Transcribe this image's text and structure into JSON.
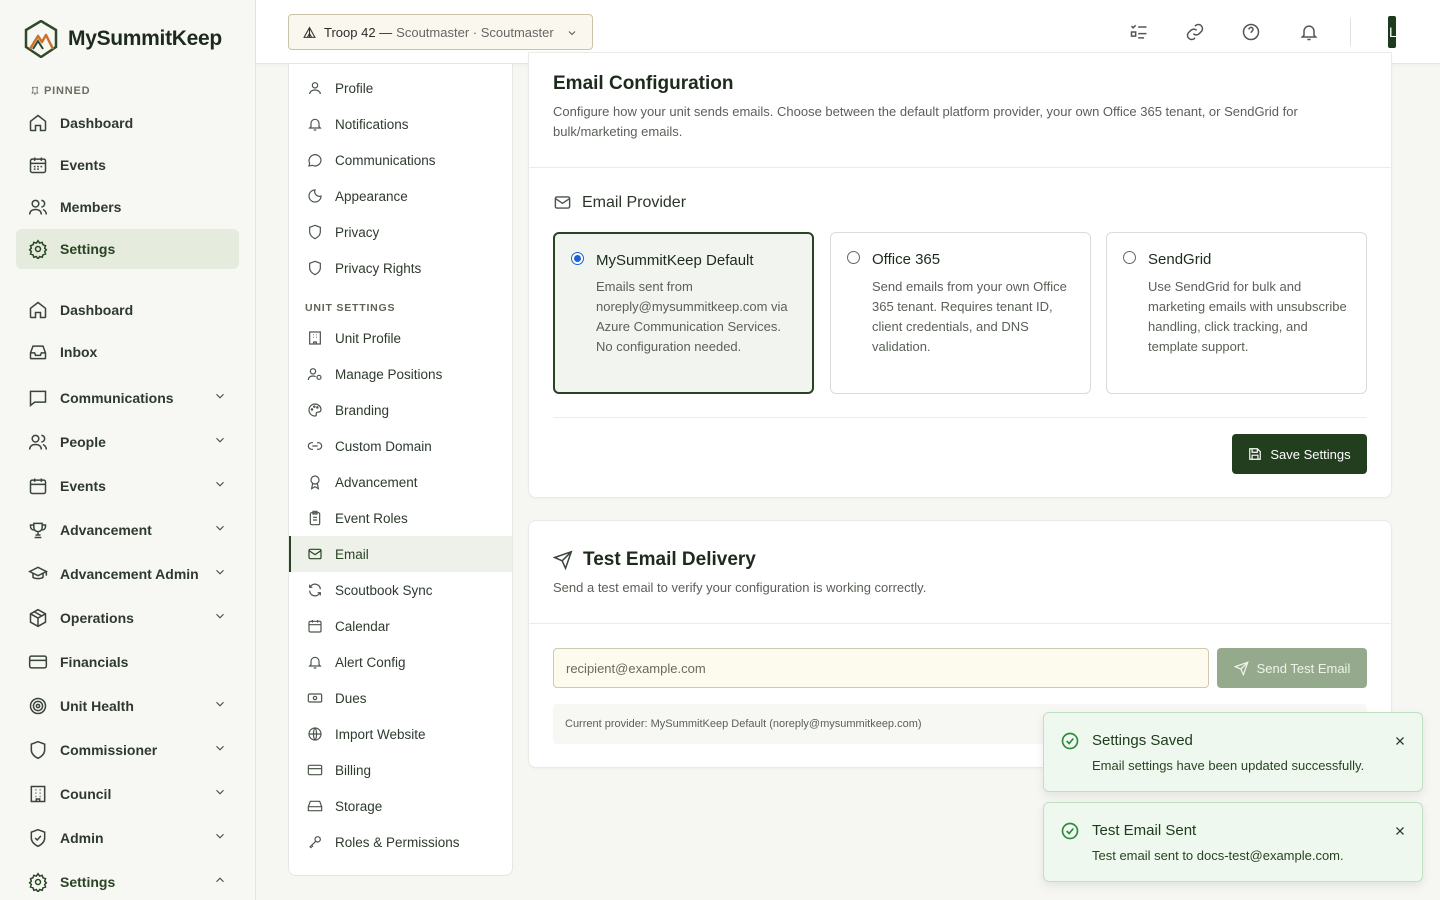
{
  "brand": {
    "name": "MySummitKeep"
  },
  "sidebar": {
    "pinned_label": "PINNED",
    "pinned": [
      {
        "label": "Dashboard"
      },
      {
        "label": "Events"
      },
      {
        "label": "Members"
      },
      {
        "label": "Settings",
        "active": true
      }
    ],
    "items": [
      {
        "label": "Dashboard"
      },
      {
        "label": "Inbox"
      },
      {
        "label": "Communications",
        "expandable": true
      },
      {
        "label": "People",
        "expandable": true
      },
      {
        "label": "Events",
        "expandable": true
      },
      {
        "label": "Advancement",
        "expandable": true
      },
      {
        "label": "Advancement Admin",
        "expandable": true
      },
      {
        "label": "Operations",
        "expandable": true
      },
      {
        "label": "Financials"
      },
      {
        "label": "Unit Health",
        "expandable": true
      },
      {
        "label": "Commissioner",
        "expandable": true
      },
      {
        "label": "Council",
        "expandable": true
      },
      {
        "label": "Admin",
        "expandable": true
      },
      {
        "label": "Settings",
        "expandable": true,
        "expanded": true
      }
    ]
  },
  "topbar": {
    "troop_name": "Troop 42 —",
    "troop_role": "Scoutmaster · Scoutmaster",
    "avatar_initial": "L"
  },
  "settings_nav": {
    "personal": [
      {
        "label": "Profile"
      },
      {
        "label": "Notifications"
      },
      {
        "label": "Communications"
      },
      {
        "label": "Appearance"
      },
      {
        "label": "Privacy"
      },
      {
        "label": "Privacy Rights"
      }
    ],
    "unit_heading": "UNIT SETTINGS",
    "unit": [
      {
        "label": "Unit Profile"
      },
      {
        "label": "Manage Positions"
      },
      {
        "label": "Branding"
      },
      {
        "label": "Custom Domain"
      },
      {
        "label": "Advancement"
      },
      {
        "label": "Event Roles"
      },
      {
        "label": "Email",
        "active": true
      },
      {
        "label": "Scoutbook Sync"
      },
      {
        "label": "Calendar"
      },
      {
        "label": "Alert Config"
      },
      {
        "label": "Dues"
      },
      {
        "label": "Import Website"
      },
      {
        "label": "Billing"
      },
      {
        "label": "Storage"
      },
      {
        "label": "Roles & Permissions"
      }
    ]
  },
  "email_config": {
    "title": "Email Configuration",
    "description": "Configure how your unit sends emails. Choose between the default platform provider, your own Office 365 tenant, or SendGrid for bulk/marketing emails.",
    "provider_section_title": "Email Provider",
    "options": [
      {
        "title": "MySummitKeep Default",
        "description": "Emails sent from noreply@mysummitkeep.com via Azure Communication Services. No configuration needed.",
        "selected": true
      },
      {
        "title": "Office 365",
        "description": "Send emails from your own Office 365 tenant. Requires tenant ID, client credentials, and DNS validation.",
        "selected": false
      },
      {
        "title": "SendGrid",
        "description": "Use SendGrid for bulk and marketing emails with unsubscribe handling, click tracking, and template support.",
        "selected": false
      }
    ],
    "save_label": "Save Settings"
  },
  "test_email": {
    "title": "Test Email Delivery",
    "description": "Send a test email to verify your configuration is working correctly.",
    "recipient_placeholder": "recipient@example.com",
    "recipient_value": "",
    "send_label": "Send Test Email",
    "current_provider": "Current provider: MySummitKeep Default (noreply@mysummitkeep.com)"
  },
  "toasts": [
    {
      "title": "Settings Saved",
      "message": "Email settings have been updated successfully."
    },
    {
      "title": "Test Email Sent",
      "message": "Test email sent to docs-test@example.com."
    }
  ],
  "colors": {
    "primary": "#233d1f",
    "accent_bg": "#e5ebdd",
    "input_bg": "#fdfaee",
    "success_bg": "#eef8ee",
    "disabled_btn": "#95aa8c"
  }
}
